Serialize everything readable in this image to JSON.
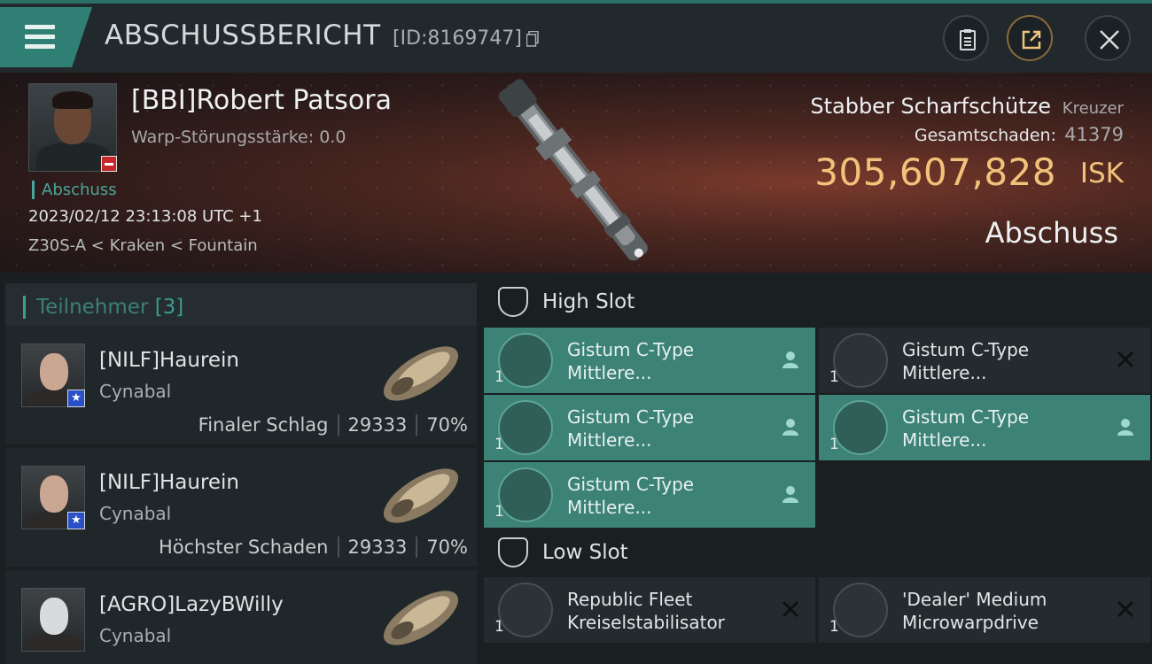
{
  "header": {
    "title": "ABSCHUSSBERICHT",
    "report_id": "[ID:8169747]",
    "accent": "#2f7f74"
  },
  "victim": {
    "name": "[BBI]Robert Patsora",
    "warp_disruption": "Warp-Störungsstärke: 0.0",
    "tag": "Abschuss",
    "time": "2023/02/12 23:13:08 UTC +1",
    "location": "Z30S-A < Kraken < Fountain"
  },
  "ship": {
    "name": "Stabber Scharfschütze",
    "class": "Kreuzer",
    "damage_label": "Gesamtschaden:",
    "damage_value": "41379",
    "isk_value": "305,607,828",
    "isk_unit": "ISK",
    "kill_type": "Abschuss"
  },
  "participants": {
    "label": "Teilnehmer",
    "count": "[3]",
    "rows": [
      {
        "name": "[NILF]Haurein",
        "ship": "Cynabal",
        "role": "Finaler Schlag",
        "damage": "29333",
        "percent": "70%"
      },
      {
        "name": "[NILF]Haurein",
        "ship": "Cynabal",
        "role": "Höchster Schaden",
        "damage": "29333",
        "percent": "70%"
      },
      {
        "name": "[AGRO]LazyBWilly",
        "ship": "Cynabal",
        "role": "",
        "damage": "",
        "percent": ""
      }
    ]
  },
  "fitting": {
    "high_slot": {
      "label": "High Slot",
      "modules": [
        {
          "qty": "1",
          "line1": "Gistum C-Type",
          "line2": "Mittlere...",
          "state": "dropped"
        },
        {
          "qty": "1",
          "line1": "Gistum C-Type",
          "line2": "Mittlere...",
          "state": "destroyed"
        },
        {
          "qty": "1",
          "line1": "Gistum C-Type",
          "line2": "Mittlere...",
          "state": "dropped"
        },
        {
          "qty": "1",
          "line1": "Gistum C-Type",
          "line2": "Mittlere...",
          "state": "dropped"
        },
        {
          "qty": "1",
          "line1": "Gistum C-Type",
          "line2": "Mittlere...",
          "state": "dropped"
        }
      ]
    },
    "low_slot": {
      "label": "Low Slot",
      "modules": [
        {
          "qty": "1",
          "line1": "Republic Fleet",
          "line2": "Kreiselstabilisator",
          "state": "destroyed"
        },
        {
          "qty": "1",
          "line1": "'Dealer' Medium",
          "line2": "Microwarpdrive",
          "state": "destroyed"
        }
      ]
    }
  },
  "colors": {
    "isk": "#f3c27a",
    "dropped_module": "#3d8276",
    "destroyed_module": "#232b2e"
  }
}
